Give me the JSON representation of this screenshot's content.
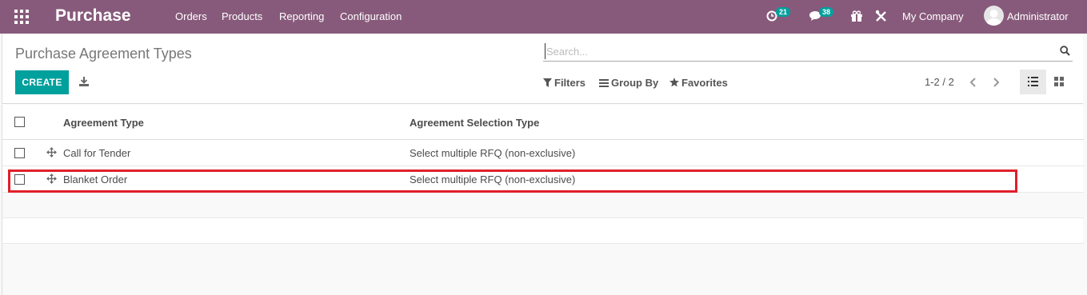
{
  "app": {
    "title": "Purchase",
    "menu": [
      "Orders",
      "Products",
      "Reporting",
      "Configuration"
    ],
    "activity_count": "21",
    "message_count": "38",
    "company": "My Company",
    "user": "Administrator"
  },
  "control_panel": {
    "page_title": "Purchase Agreement Types",
    "search_placeholder": "Search...",
    "create_label": "CREATE",
    "filters_label": "Filters",
    "group_by_label": "Group By",
    "favorites_label": "Favorites",
    "pager_value": "1-2 / 2"
  },
  "table": {
    "columns": [
      "Agreement Type",
      "Agreement Selection Type"
    ],
    "rows": [
      {
        "agreement_type": "Call for Tender",
        "selection_type": "Select multiple RFQ (non-exclusive)"
      },
      {
        "agreement_type": "Blanket Order",
        "selection_type": "Select multiple RFQ (non-exclusive)"
      }
    ]
  },
  "colors": {
    "brand": "#875a7b",
    "primary_button": "#00a09d",
    "badge": "#00a09d",
    "highlight_box": "#e0202a"
  }
}
